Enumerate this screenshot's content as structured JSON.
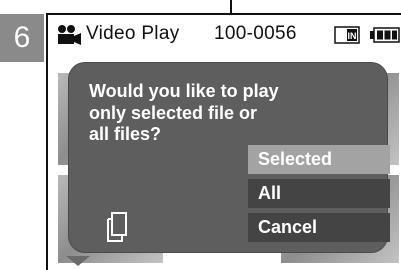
{
  "step": {
    "number": "6"
  },
  "status_bar": {
    "mode_icon": "video-play-icon",
    "mode_label": "Video Play",
    "file_number": "100-0056",
    "memory_icon": "memory-card-icon",
    "battery_icon": "battery-icon"
  },
  "dialog": {
    "message_lines": [
      "Would you like to play",
      "only selected file or",
      "all files?"
    ],
    "options": [
      {
        "label": "Selected",
        "selected": true
      },
      {
        "label": "All",
        "selected": false
      },
      {
        "label": "Cancel",
        "selected": false
      }
    ],
    "copy_icon": "copy-icon"
  },
  "colors": {
    "dialog_bg": "#5e5e5e",
    "option_bg": "#444444",
    "option_selected_bg": "#a3a3a3",
    "step_badge_bg": "#8a8a8a"
  }
}
